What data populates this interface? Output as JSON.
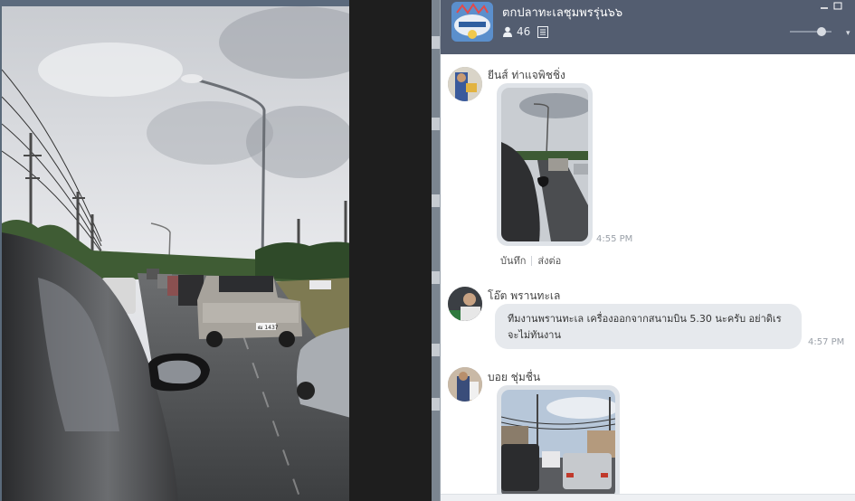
{
  "chat": {
    "group_name": "ตกปลาทะเลชุมพรรุ่น๖๖",
    "member_count": "46",
    "member_icon": "person-icon",
    "notes_icon": "note-icon"
  },
  "messages": [
    {
      "sender": "ยีนส์ ท่าแจพิชชิ่ง",
      "type": "image",
      "time": "4:55 PM",
      "actions": [
        "บันทึก",
        "ส่งต่อ"
      ]
    },
    {
      "sender": "โอ๊ต พรานทะเล",
      "type": "text",
      "text_line1": "ทีมงานพรานทะเล เครื่องออกจากสนามบิน 5.30 นะครับ อย่าดิเร",
      "text_line2": "จะไม่ทันงาน",
      "time": "4:57 PM"
    },
    {
      "sender": "บอย ชุ่มชื่น",
      "type": "image"
    }
  ],
  "photo": {
    "plate_text": "ฒ 1437"
  },
  "colors": {
    "header_bg": "#535d70",
    "bubble_bg": "#e6e9ed",
    "sky": "#dfe2e6"
  }
}
